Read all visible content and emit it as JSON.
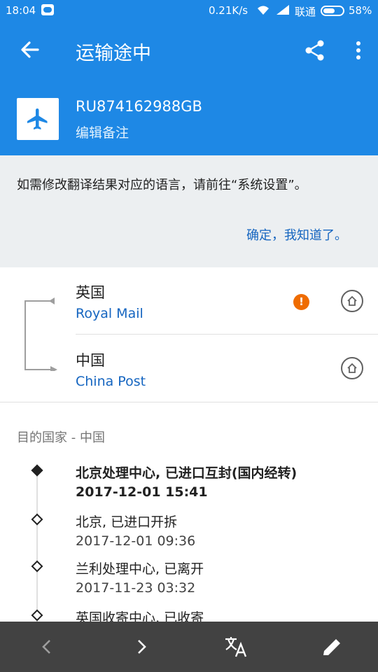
{
  "status_bar": {
    "time": "18:04",
    "network_speed": "0.21K/s",
    "carrier": "联通",
    "battery": "58%",
    "battery_level": 0.58
  },
  "app_bar": {
    "title": "运输途中",
    "tracking_number": "RU874162988GB",
    "edit_note": "编辑备注",
    "accent_color": "#1e88e5"
  },
  "notice": {
    "message": "如需修改翻译结果对应的语言，请前往“系统设置”。",
    "confirm": "确定，我知道了。"
  },
  "route": {
    "origin": {
      "country": "英国",
      "carrier": "Royal Mail",
      "warning": "!"
    },
    "destination": {
      "country": "中国",
      "carrier": "China Post"
    }
  },
  "timeline": {
    "section_title": "目的国家 - 中国",
    "events": [
      {
        "place": "北京处理中心, 已进口互封(国内经转)",
        "time": "2017-12-01 15:41"
      },
      {
        "place": "北京, 已进口开拆",
        "time": "2017-12-01 09:36"
      },
      {
        "place": "兰利处理中心, 已离开",
        "time": "2017-11-23 03:32"
      },
      {
        "place": "英国收寄中心, 已收寄",
        "time": ""
      }
    ]
  },
  "bottom_bar": {
    "icons": [
      "chevron-left-icon",
      "chevron-right-icon",
      "translate-icon",
      "pencil-icon"
    ]
  }
}
